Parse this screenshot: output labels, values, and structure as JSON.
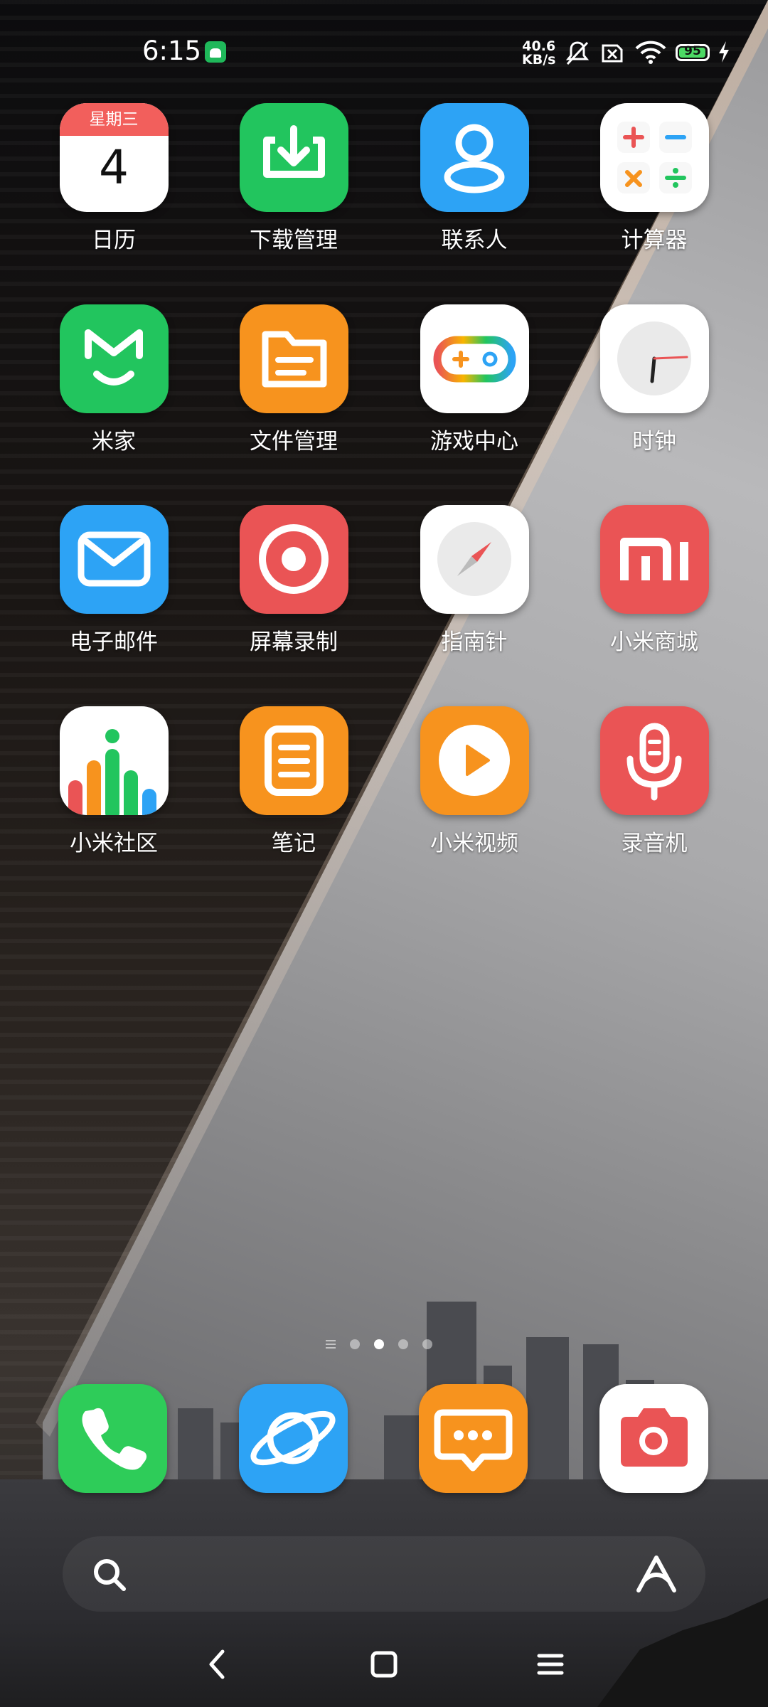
{
  "status_bar": {
    "time": "6:15",
    "net_speed_value": "40.6",
    "net_speed_unit": "KB/s",
    "battery_level": "95",
    "icons": [
      "android-notification-icon",
      "mute-bell-icon",
      "no-sim-icon",
      "wifi-icon",
      "battery-icon",
      "charging-bolt-icon"
    ]
  },
  "calendar": {
    "weekday": "星期三",
    "day": "4"
  },
  "apps": [
    {
      "label": "日历",
      "icon": "calendar-icon"
    },
    {
      "label": "下载管理",
      "icon": "download-icon"
    },
    {
      "label": "联系人",
      "icon": "contacts-icon"
    },
    {
      "label": "计算器",
      "icon": "calculator-icon"
    },
    {
      "label": "米家",
      "icon": "mijia-icon"
    },
    {
      "label": "文件管理",
      "icon": "file-manager-icon"
    },
    {
      "label": "游戏中心",
      "icon": "game-center-icon"
    },
    {
      "label": "时钟",
      "icon": "clock-icon"
    },
    {
      "label": "电子邮件",
      "icon": "email-icon"
    },
    {
      "label": "屏幕录制",
      "icon": "screen-record-icon"
    },
    {
      "label": "指南针",
      "icon": "compass-icon"
    },
    {
      "label": "小米商城",
      "icon": "mi-store-icon"
    },
    {
      "label": "小米社区",
      "icon": "mi-community-icon"
    },
    {
      "label": "笔记",
      "icon": "notes-icon"
    },
    {
      "label": "小米视频",
      "icon": "mi-video-icon"
    },
    {
      "label": "录音机",
      "icon": "recorder-icon"
    }
  ],
  "dock": [
    {
      "name": "phone",
      "icon": "phone-icon",
      "color": "#2ecc59"
    },
    {
      "name": "browser",
      "icon": "browser-icon",
      "color": "#2da3f5"
    },
    {
      "name": "messages",
      "icon": "messages-icon",
      "color": "#f7931e"
    },
    {
      "name": "camera",
      "icon": "camera-icon",
      "color": "#ffffff"
    }
  ],
  "page_indicator": {
    "pages": 4,
    "active_page": 2
  },
  "search_bar": {
    "icons": [
      "search-icon",
      "assistant-icon"
    ]
  },
  "nav_bar": {
    "buttons": [
      "back-icon",
      "home-icon",
      "recents-icon"
    ]
  },
  "colors": {
    "green": "#22c55e",
    "blue": "#2da3f5",
    "orange": "#f7931e",
    "red": "#ea5455",
    "white": "#ffffff"
  }
}
